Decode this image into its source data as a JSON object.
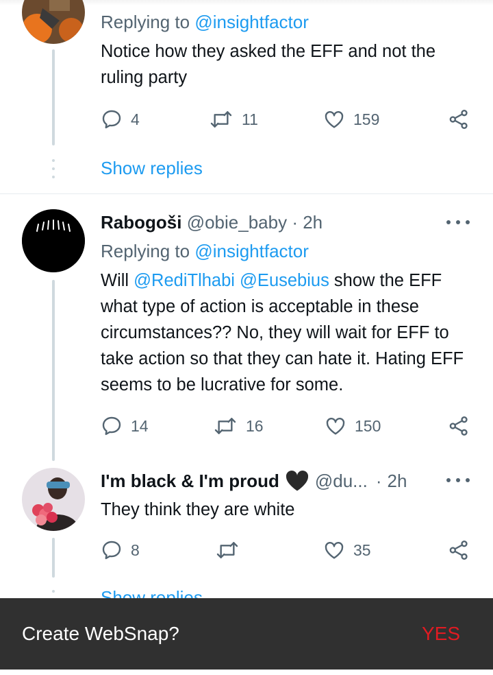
{
  "tweets": [
    {
      "reply_to_prefix": "Replying to ",
      "reply_to_handle": "@insightfactor",
      "text": "Notice how they asked the EFF and not the ruling party",
      "replies": "4",
      "retweets": "11",
      "likes": "159",
      "show_replies": "Show replies"
    },
    {
      "name": "Rabogoši",
      "handle": "@obie_baby",
      "separator": "·",
      "time": "2h",
      "reply_to_prefix": "Replying to ",
      "reply_to_handle": "@insightfactor",
      "text_start": "Will ",
      "mention1": "@RediTlhabi",
      "text_space": " ",
      "mention2": "@Eusebius",
      "text_rest": " show the EFF what type of action is acceptable in these circumstances?? No, they will wait for EFF to take action so that they can hate it. Hating EFF seems to be lucrative for some.",
      "replies": "14",
      "retweets": "16",
      "likes": "150"
    },
    {
      "name": "I'm black & I'm proud",
      "handle": "@du...",
      "separator": "·",
      "time": "2h",
      "text": "They think they are white",
      "replies": "8",
      "retweets": "",
      "likes": "35",
      "show_replies_partial": "Show replies"
    }
  ],
  "snackbar": {
    "text": "Create WebSnap?",
    "action": "YES"
  },
  "icons": {
    "reply": "reply-icon",
    "retweet": "retweet-icon",
    "like": "heart-icon",
    "share": "share-icon",
    "more": "more-options-icon",
    "heart_emoji": "black-heart-emoji"
  },
  "colors": {
    "link": "#1d9bf0",
    "muted": "#536471",
    "snackbar_bg": "#303030",
    "snackbar_action": "#e01b22"
  }
}
